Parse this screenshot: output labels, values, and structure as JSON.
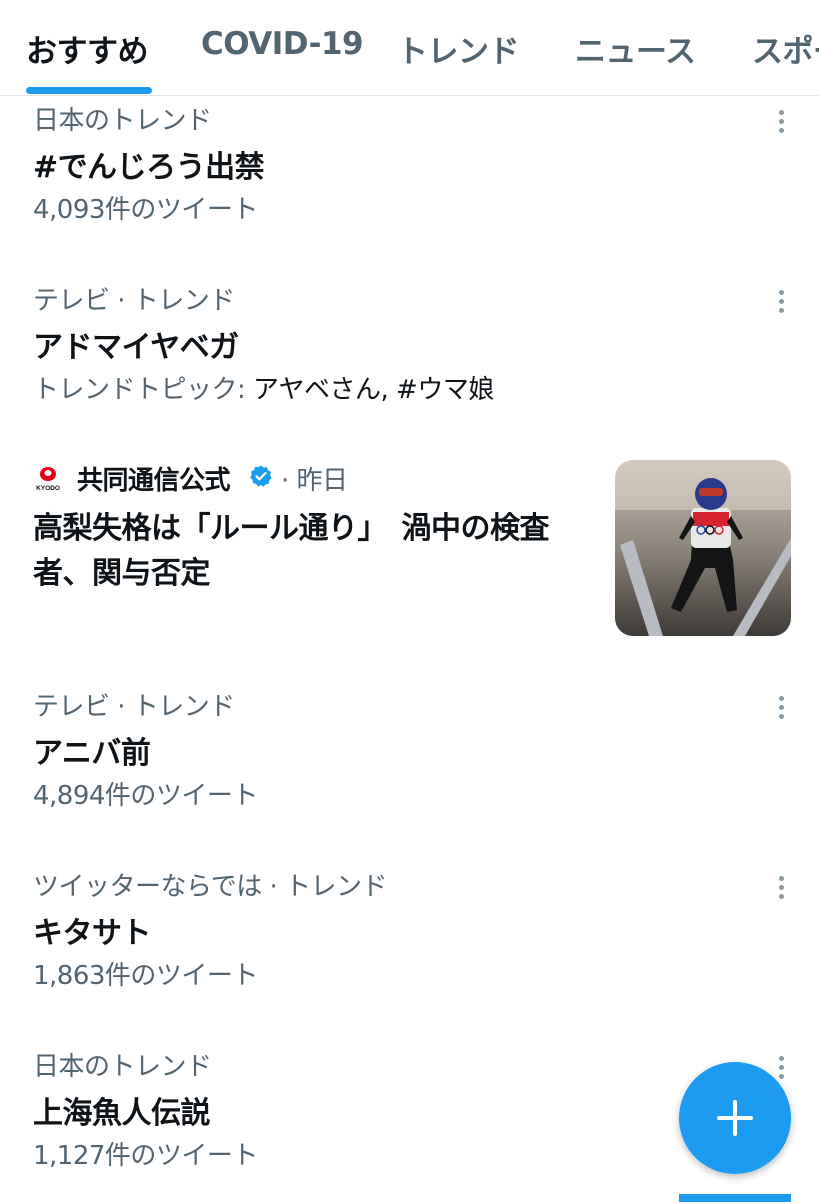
{
  "tabs": [
    {
      "label": "おすすめ",
      "active": true
    },
    {
      "label": "COVID-19",
      "active": false
    },
    {
      "label": "トレンド",
      "active": false
    },
    {
      "label": "ニュース",
      "active": false
    },
    {
      "label": "スポーツ",
      "active": false
    }
  ],
  "trends": [
    {
      "meta": "日本のトレンド",
      "name": "#でんじろう出禁",
      "count": "4,093件のツイート"
    },
    {
      "meta": "テレビ · トレンド",
      "name": "アドマイヤベガ",
      "topics_label": "トレンドトピック:",
      "topics": "アヤベさん, #ウマ娘"
    },
    {
      "meta": "テレビ · トレンド",
      "name": "アニバ前",
      "count": "4,894件のツイート"
    },
    {
      "meta": "ツイッターならでは · トレンド",
      "name": "キタサト",
      "count": "1,863件のツイート"
    },
    {
      "meta": "日本のトレンド",
      "name": "上海魚人伝説",
      "count": "1,127件のツイート"
    }
  ],
  "news": {
    "source": "共同通信公式",
    "time": "· 昨日",
    "headline": "高梨失格は「ルール通り」　渦中の検査者、関与否定",
    "logo_text": "KYODO"
  },
  "icons": {
    "more": "more-vertical-icon",
    "verified": "verified-badge-icon",
    "compose": "plus-icon"
  },
  "colors": {
    "accent": "#1d9bf0",
    "text_primary": "#0f1419",
    "text_secondary": "#536471"
  }
}
